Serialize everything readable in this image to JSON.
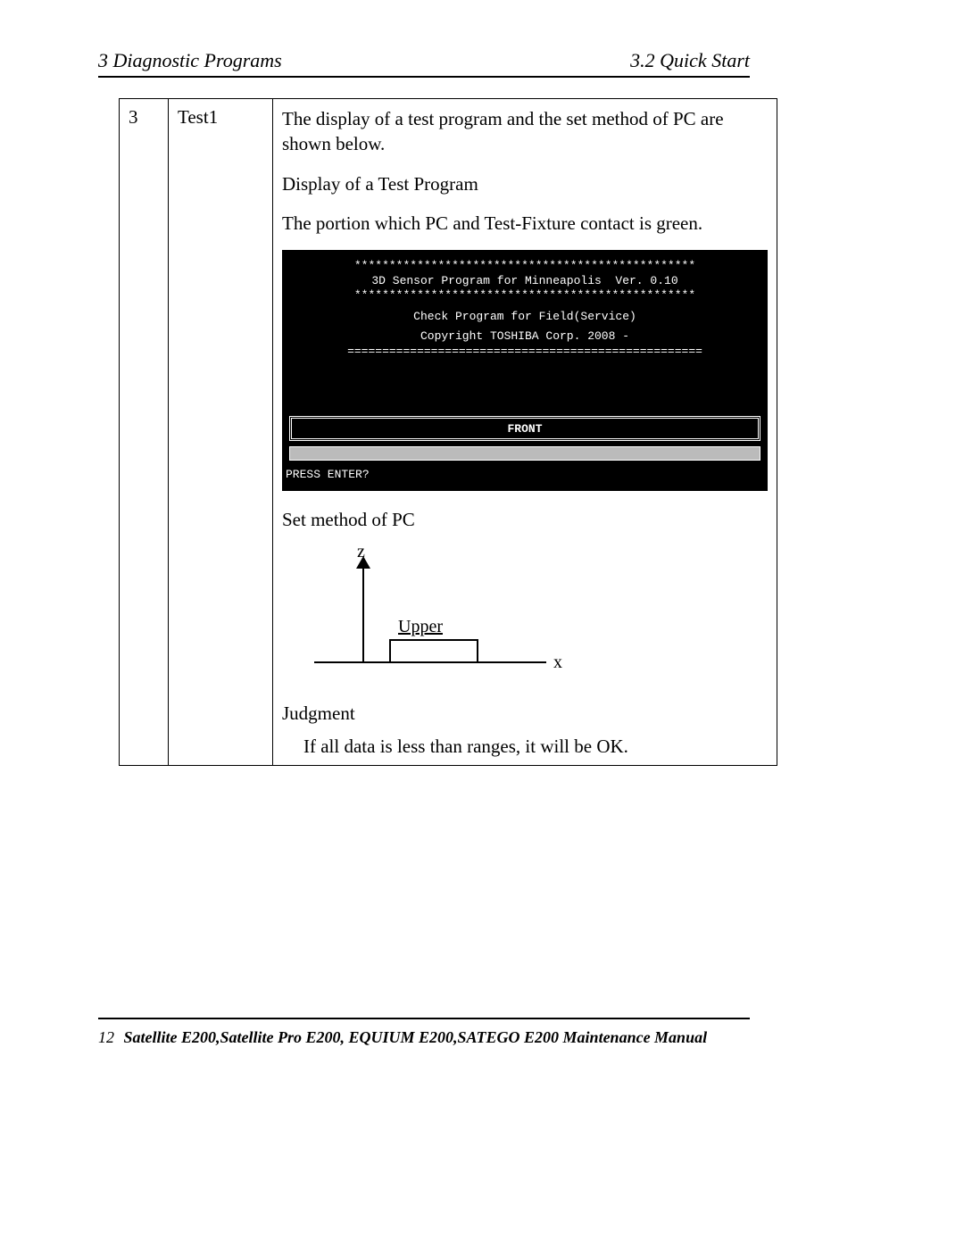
{
  "header": {
    "left": "3  Diagnostic Programs",
    "right": "3.2 Quick Start"
  },
  "table": {
    "row": {
      "num": "3",
      "name": "Test1",
      "intro": "The display of a test program and the set method of PC are shown below.",
      "displayTitle": "Display of a Test Program",
      "greenNote": "The portion which PC and Test-Fixture contact is green.",
      "console": {
        "stars": "*************************************************",
        "title": "3D Sensor Program for Minneapolis  Ver. 0.10",
        "check": "Check Program for Field(Service)",
        "copyright": "Copyright TOSHIBA Corp. 2008 -",
        "dashes": "===================================================",
        "front": "FRONT",
        "prompt": "PRESS ENTER?"
      },
      "setMethod": "Set method of PC",
      "axis": {
        "z": "z",
        "x": "x",
        "upper": "Upper"
      },
      "judgmentTitle": "Judgment",
      "judgmentBody": "If all data is less than ranges, it will be OK."
    }
  },
  "footer": {
    "page": "12",
    "title": "Satellite E200,Satellite Pro E200, EQUIUM E200,SATEGO E200 Maintenance Manual"
  }
}
